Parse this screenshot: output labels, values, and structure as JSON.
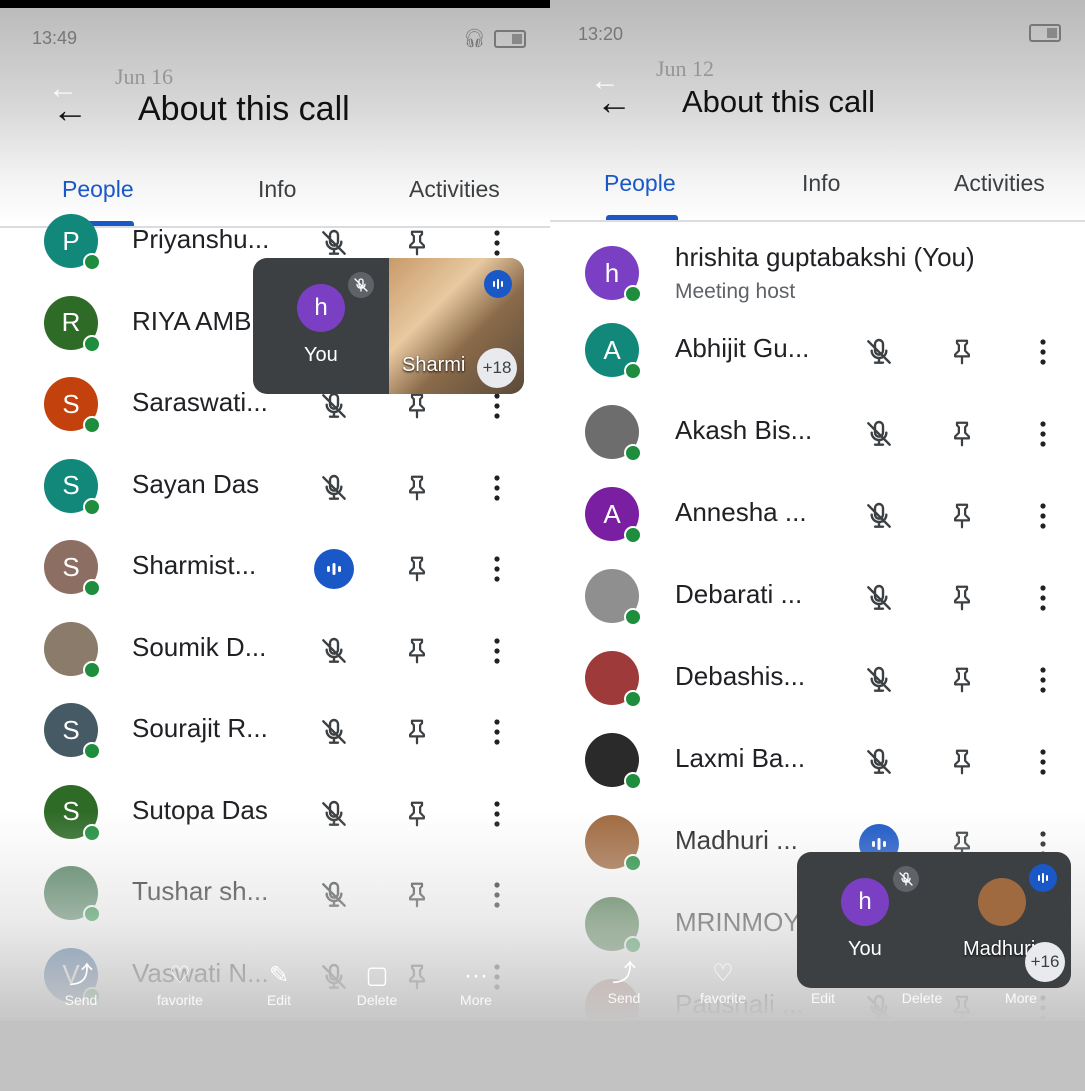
{
  "left": {
    "status_time": "13:49",
    "ghost_date": "Jun 16",
    "title": "About this call",
    "tabs": [
      "People",
      "Info",
      "Activities"
    ],
    "active_tab": 0,
    "participants": [
      {
        "name": "Priyanshu...",
        "initial": "P",
        "color": "#12887b",
        "state": "muted"
      },
      {
        "name": "RIYA AMB",
        "initial": "R",
        "color": "#2e6b27",
        "state": "muted"
      },
      {
        "name": "Saraswati...",
        "initial": "S",
        "color": "#c2410c",
        "state": "muted"
      },
      {
        "name": "Sayan Das",
        "initial": "S",
        "color": "#12887b",
        "state": "muted"
      },
      {
        "name": "Sharmist...",
        "initial": "S",
        "color": "#8d6e63",
        "state": "speaking"
      },
      {
        "name": "Soumik D...",
        "initial": "",
        "color": "#8a7b6a",
        "state": "muted"
      },
      {
        "name": "Sourajit R...",
        "initial": "S",
        "color": "#455a64",
        "state": "muted"
      },
      {
        "name": "Sutopa Das",
        "initial": "S",
        "color": "#2e6b27",
        "state": "muted"
      },
      {
        "name": "Tushar sh...",
        "initial": "",
        "color": "#4a7c59",
        "state": "muted"
      },
      {
        "name": "Vaswati N...",
        "initial": "V",
        "color": "#1a4f8a",
        "state": "muted"
      }
    ],
    "actions": [
      {
        "icon": "share-icon",
        "glyph": "⤴",
        "label": "Send"
      },
      {
        "icon": "heart-icon",
        "glyph": "♡",
        "label": "favorite"
      },
      {
        "icon": "edit-icon",
        "glyph": "✎",
        "label": "Edit"
      },
      {
        "icon": "trash-icon",
        "glyph": "▢",
        "label": "Delete"
      },
      {
        "icon": "more-icon",
        "glyph": "···",
        "label": "More"
      }
    ],
    "pip": {
      "self_initial": "h",
      "self_label": "You",
      "other_label": "Sharmi",
      "count": "+18"
    }
  },
  "right": {
    "status_time": "13:20",
    "ghost_date": "Jun 12",
    "title": "About this call",
    "tabs": [
      "People",
      "Info",
      "Activities"
    ],
    "active_tab": 0,
    "host": {
      "name": "hrishita guptabakshi (You)",
      "initial": "h",
      "color": "#7b3fc4",
      "subtitle": "Meeting host"
    },
    "participants": [
      {
        "name": "Abhijit Gu...",
        "initial": "A",
        "color": "#12887b",
        "state": "muted"
      },
      {
        "name": "Akash Bis...",
        "initial": "",
        "color": "#6d6d6d",
        "state": "muted"
      },
      {
        "name": "Annesha ...",
        "initial": "A",
        "color": "#7b1fa2",
        "state": "muted"
      },
      {
        "name": "Debarati ...",
        "initial": "",
        "color": "#8f8f8f",
        "state": "muted"
      },
      {
        "name": "Debashis...",
        "initial": "",
        "color": "#9e3a3a",
        "state": "muted"
      },
      {
        "name": "Laxmi Ba...",
        "initial": "",
        "color": "#2a2a2a",
        "state": "muted"
      },
      {
        "name": "Madhuri ...",
        "initial": "",
        "color": "#a06a40",
        "state": "speaking"
      },
      {
        "name": "MRINMOY",
        "initial": "",
        "color": "#3b6e3b",
        "state": "muted"
      },
      {
        "name": "Paushali ...",
        "initial": "",
        "color": "#b0705a",
        "state": "muted"
      }
    ],
    "actions": [
      {
        "icon": "share-icon",
        "glyph": "⤴",
        "label": "Send"
      },
      {
        "icon": "heart-icon",
        "glyph": "♡",
        "label": "favorite"
      },
      {
        "icon": "edit-icon",
        "glyph": "✎",
        "label": "Edit"
      },
      {
        "icon": "trash-icon",
        "glyph": "▢",
        "label": "Delete"
      },
      {
        "icon": "more-icon",
        "glyph": "···",
        "label": "More"
      }
    ],
    "pip": {
      "self_initial": "h",
      "self_label": "You",
      "other_label": "Madhuri",
      "count": "+16"
    }
  }
}
